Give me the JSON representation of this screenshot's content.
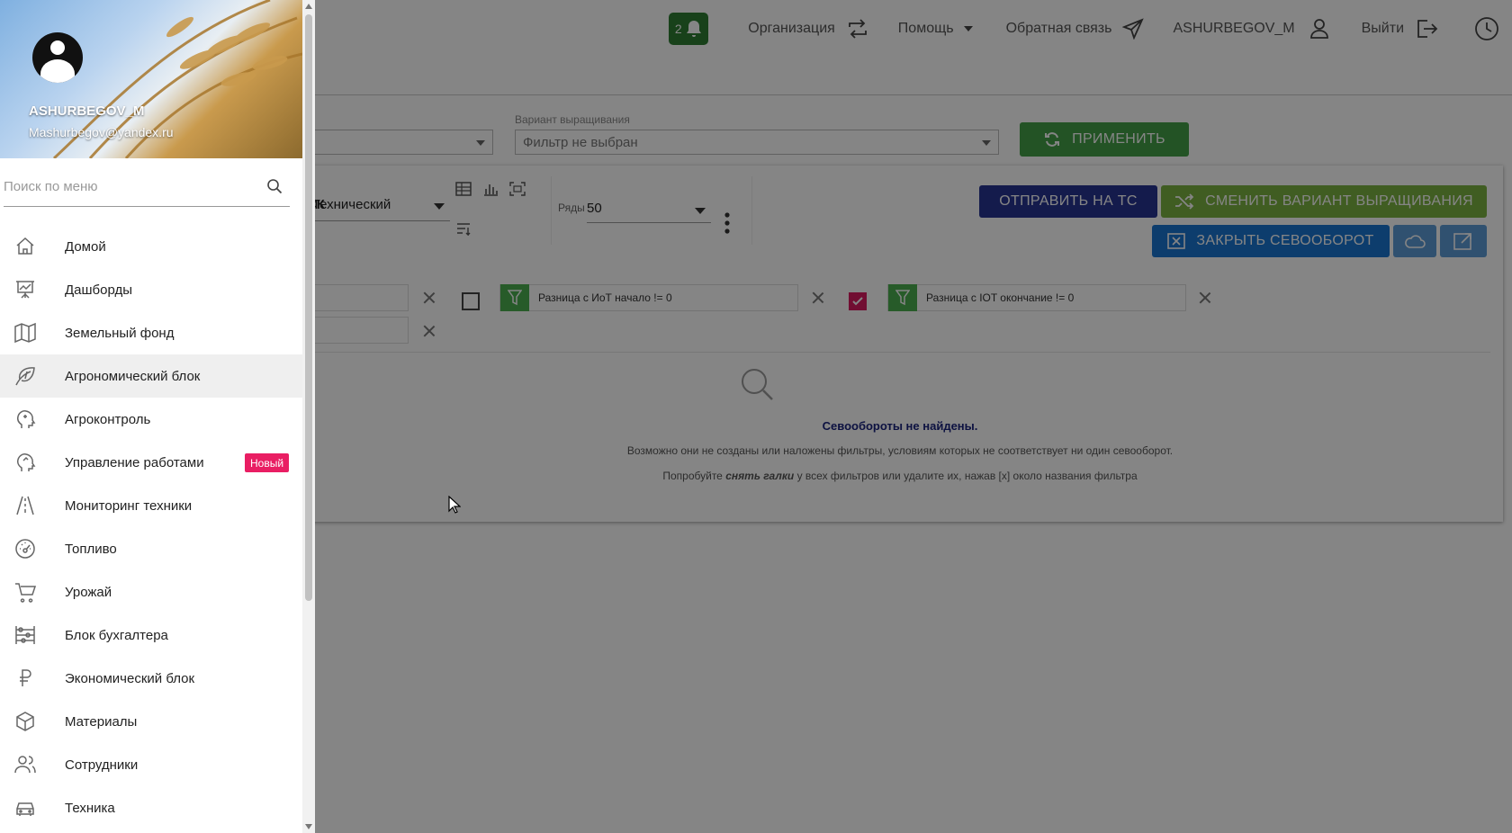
{
  "topnav": {
    "notifications_count": "2",
    "organization": "Организация",
    "help": "Помощь",
    "feedback": "Обратная связь",
    "user": "ASHURBEGOV_M",
    "logout": "Выйти"
  },
  "filters": {
    "variant_label": "Вариант выращивания",
    "variant_value": "Фильтр не выбран",
    "apply": "ПРИМЕНИТЬ"
  },
  "toolbar": {
    "mode_prefix": "ФСК",
    "mode_value": "Технический",
    "rows_label": "Ряды",
    "rows_value": "50",
    "send": "ОТПРАВИТЬ НА ТС",
    "change_variant": "СМЕНИТЬ ВАРИАНТ ВЫРАЩИВАНИЯ",
    "close_rotation": "ЗАКРЫТЬ СЕВООБОРОТ"
  },
  "chips": [
    {
      "text": "Разница с ИоТ начало != 0",
      "checked": false
    },
    {
      "text": "Разница с IOT окончание != 0",
      "checked": true
    }
  ],
  "empty": {
    "title": "Севообороты не найдены.",
    "line1": "Возможно они не созданы или наложены фильтры, условиям которых не соответствует ни один севооборот.",
    "line2_pre": "Попробуйте ",
    "line2_em": "снять галки",
    "line2_post": " у всех фильтров или удалите их, нажав [x] около названия фильтра"
  },
  "drawer": {
    "user_name": "ASHURBEGOV_M",
    "user_email": "Mashurbegov@yandex.ru",
    "search_placeholder": "Поиск по меню",
    "items": [
      {
        "label": "Домой",
        "icon": "home-icon"
      },
      {
        "label": "Дашборды",
        "icon": "presentation-chart-icon"
      },
      {
        "label": "Земельный фонд",
        "icon": "map-icon"
      },
      {
        "label": "Агрономический блок",
        "icon": "leaf-icon"
      },
      {
        "label": "Агроконтроль",
        "icon": "head-icon"
      },
      {
        "label": "Управление работами",
        "icon": "head-icon",
        "badge": "Новый"
      },
      {
        "label": "Мониторинг техники",
        "icon": "road-icon"
      },
      {
        "label": "Топливо",
        "icon": "gauge-icon"
      },
      {
        "label": "Урожай",
        "icon": "cart-icon"
      },
      {
        "label": "Блок бухгалтера",
        "icon": "abacus-icon"
      },
      {
        "label": "Экономический блок",
        "icon": "ruble-icon"
      },
      {
        "label": "Материалы",
        "icon": "box-icon"
      },
      {
        "label": "Сотрудники",
        "icon": "users-icon"
      },
      {
        "label": "Техника",
        "icon": "car-icon"
      }
    ]
  },
  "colors": {
    "green": "#43a047",
    "navy": "#283593",
    "lime": "#7cb342",
    "blue": "#1976d2",
    "badge": "#e91e63"
  }
}
